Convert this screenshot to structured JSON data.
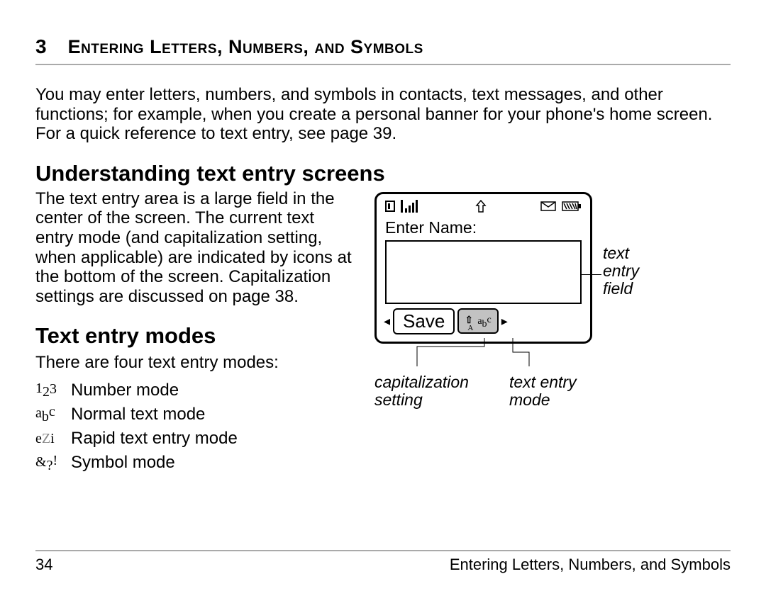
{
  "chapter": {
    "number": "3",
    "title": "Entering Letters, Numbers, and Symbols"
  },
  "intro": "You may enter letters, numbers, and symbols in contacts, text messages, and other functions; for example, when you create a personal banner for your phone's home screen. For a quick reference to text entry, see page 39.",
  "sections": {
    "understanding": {
      "heading": "Understanding text entry screens",
      "body": "The text entry area is a large field in the center of the screen. The current text entry mode (and capitalization setting, when applicable) are indicated by icons at the bottom of the screen. Capitalization settings are discussed on page 38."
    },
    "modes": {
      "heading": "Text entry modes",
      "intro": "There are four text entry modes:",
      "items": [
        {
          "label": "Number mode"
        },
        {
          "label": "Normal text mode"
        },
        {
          "label": "Rapid text entry mode"
        },
        {
          "label": "Symbol mode"
        }
      ]
    }
  },
  "diagram": {
    "screen_title": "Enter Name:",
    "save_label": "Save",
    "callout_field": "text entry field",
    "callout_cap": "capitalization setting",
    "callout_mode": "text entry mode"
  },
  "footer": {
    "page": "34",
    "running": "Entering Letters, Numbers, and Symbols"
  }
}
